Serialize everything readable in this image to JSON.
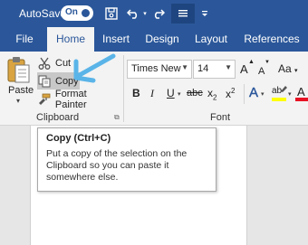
{
  "titlebar": {
    "autosave_label": "AutoSave",
    "autosave_state": "On",
    "icons": [
      "save-icon",
      "undo-icon",
      "redo-icon",
      "touch-mode-icon",
      "customize-qat-icon"
    ]
  },
  "tabs": [
    {
      "label": "File",
      "active": false
    },
    {
      "label": "Home",
      "active": true
    },
    {
      "label": "Insert",
      "active": false
    },
    {
      "label": "Design",
      "active": false
    },
    {
      "label": "Layout",
      "active": false
    },
    {
      "label": "References",
      "active": false
    }
  ],
  "clipboard": {
    "paste_label": "Paste",
    "cut_label": "Cut",
    "copy_label": "Copy",
    "format_painter_label": "Format Painter",
    "group_label": "Clipboard"
  },
  "font": {
    "font_name": "Times New R",
    "font_size": "14",
    "grow_label": "A",
    "shrink_label": "A",
    "change_case_label": "Aa",
    "bold_label": "B",
    "italic_label": "I",
    "underline_label": "U",
    "strikethrough_label": "abc",
    "subscript_label": "x",
    "subscript_mark": "2",
    "superscript_label": "x",
    "superscript_mark": "2",
    "text_effects_label": "A",
    "highlight_label": "ab",
    "font_color_label": "A",
    "group_label": "Font"
  },
  "tooltip": {
    "title": "Copy (Ctrl+C)",
    "body": "Put a copy of the selection on the Clipboard so you can paste it somewhere else."
  },
  "colors": {
    "brand_blue": "#2b579a",
    "annotation_arrow": "#5ab4e8",
    "highlight_yellow": "#ffff00",
    "font_color_red": "#e81123"
  }
}
